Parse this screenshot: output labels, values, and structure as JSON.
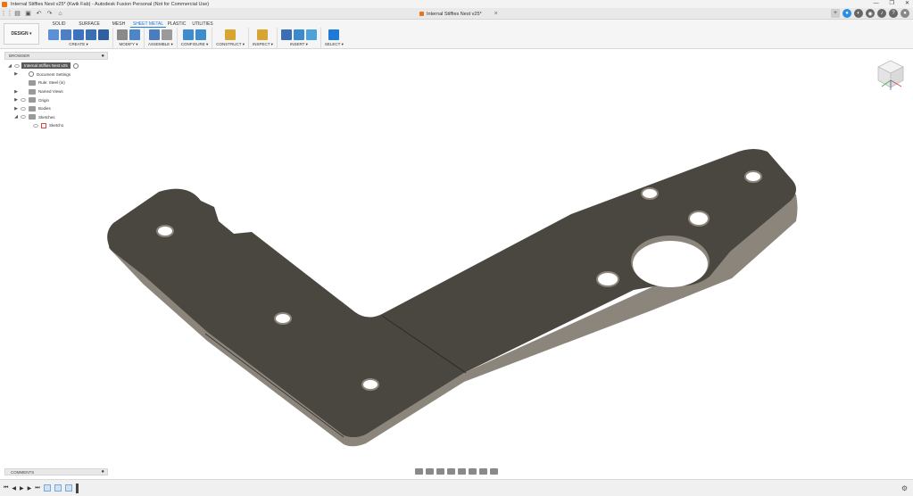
{
  "window": {
    "title": "Internal Stiffies Nest v25* (Kwik Fab) - Autodesk Fusion Personal (Not for Commercial Use)",
    "minimize": "—",
    "maximize": "❐",
    "close": "✕"
  },
  "document_tab": {
    "label": "Internal Stiffies Nest v25*",
    "close": "×"
  },
  "workspace": {
    "label": "DESIGN ▾"
  },
  "ribbon_tabs": [
    "SOLID",
    "SURFACE",
    "MESH",
    "SHEET METAL",
    "PLASTIC",
    "UTILITIES"
  ],
  "active_tab": "SHEET METAL",
  "tool_groups": [
    {
      "label": "CREATE ▾",
      "icons": [
        "#5b8fd6",
        "#4d7fc4",
        "#3b73c0",
        "#3a6fb5",
        "#2f5f9e"
      ]
    },
    {
      "label": "MODIFY ▾",
      "icons": [
        "#8a8a8a",
        "#4d86c8"
      ]
    },
    {
      "label": "ASSEMBLE ▾",
      "icons": [
        "#4a7cc0",
        "#9a9a9a"
      ]
    },
    {
      "label": "CONFIGURE ▾",
      "icons": [
        "#3d8ccf",
        "#3d8ccf"
      ]
    },
    {
      "label": "CONSTRUCT ▾",
      "icons": [
        "#d9a531"
      ]
    },
    {
      "label": "INSPECT ▾",
      "icons": [
        "#d9a531"
      ]
    },
    {
      "label": "INSERT ▾",
      "icons": [
        "#3a6fb5",
        "#3a8ad0",
        "#4da3d9"
      ]
    },
    {
      "label": "SELECT ▾",
      "icons": [
        "#1e7ad6"
      ]
    }
  ],
  "browser": {
    "title": "BROWSER",
    "root": "Internal Stiffies Nest v25",
    "items": [
      {
        "label": "Document Settings",
        "icon": "gear",
        "expander": "▶",
        "eye": false
      },
      {
        "label": "Rule: Steel (in)",
        "icon": "sheet",
        "expander": "",
        "eye": false
      },
      {
        "label": "Named Views",
        "icon": "folder",
        "expander": "▶",
        "eye": false
      },
      {
        "label": "Origin",
        "icon": "folder",
        "expander": "▶",
        "eye": true
      },
      {
        "label": "Bodies",
        "icon": "folder",
        "expander": "▶",
        "eye": true
      },
      {
        "label": "Sketches",
        "icon": "folder",
        "expander": "◢",
        "eye": true
      },
      {
        "label": "Sketch1",
        "icon": "sketch",
        "expander": "",
        "eye": true
      }
    ]
  },
  "comments": {
    "label": "COMMENTS"
  },
  "colors": {
    "accent": "#1e7ad6",
    "part_face": "#4a4640",
    "part_edge": "#8b857b",
    "brand": "#e8741c"
  }
}
